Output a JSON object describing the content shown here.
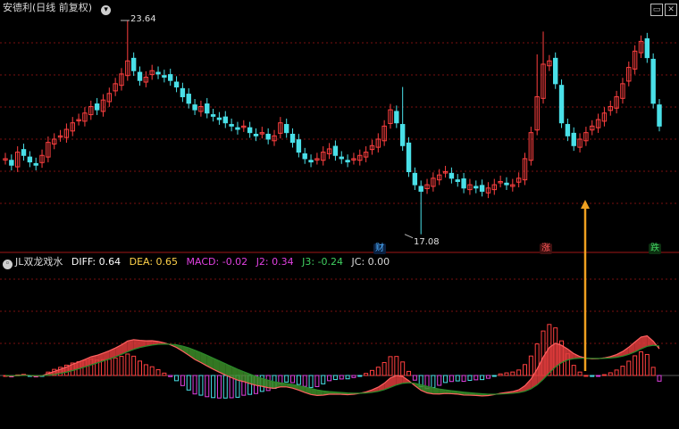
{
  "header": {
    "stock_name": "安德利(日线 前复权)",
    "dropdown_icon": "chevron-down-icon"
  },
  "window_controls": {
    "minimize_icon": "minimize-icon",
    "close_icon": "close-icon"
  },
  "price_annotations": {
    "high_label": "23.64",
    "low_label": "17.08"
  },
  "event_markers": [
    {
      "label": "财",
      "color": "#4fb0ff"
    },
    {
      "label": "涨",
      "color": "#ff5a5a"
    },
    {
      "label": "跌",
      "color": "#40d060"
    }
  ],
  "indicator": {
    "name": "JL双龙戏水",
    "values": [
      {
        "label": "DIFF: 0.64",
        "color": "#ffffff"
      },
      {
        "label": "DEA: 0.65",
        "color": "#ffd24a"
      },
      {
        "label": "MACD: -0.02",
        "color": "#e040e0"
      },
      {
        "label": "J2: 0.34",
        "color": "#e040e0"
      },
      {
        "label": "J3: -0.24",
        "color": "#40d060"
      },
      {
        "label": "JC: 0.00",
        "color": "#d8d8d8"
      }
    ]
  },
  "colors": {
    "up": "#ff4040",
    "down": "#4ae0e8",
    "grid": "#7a1010",
    "arrow": "#f0a020",
    "band_red": "#e03c3c",
    "band_green": "#3c8c28"
  },
  "chart_data": {
    "type": "candlestick",
    "price_high": 23.64,
    "price_low": 17.08,
    "closes": [
      19.4,
      19.2,
      19.6,
      19.5,
      19.3,
      19.2,
      19.5,
      19.9,
      20.0,
      20.1,
      20.3,
      20.5,
      20.6,
      20.8,
      21.0,
      20.9,
      21.2,
      21.4,
      21.7,
      22.0,
      22.4,
      22.1,
      21.8,
      21.9,
      22.1,
      22.0,
      21.9,
      21.8,
      21.6,
      21.3,
      21.1,
      20.9,
      21.0,
      20.8,
      20.7,
      20.6,
      20.5,
      20.4,
      20.3,
      20.4,
      20.2,
      20.1,
      20.2,
      20.0,
      20.1,
      20.5,
      20.2,
      19.9,
      19.6,
      19.4,
      19.3,
      19.4,
      19.6,
      19.7,
      19.5,
      19.4,
      19.3,
      19.4,
      19.5,
      19.6,
      19.8,
      20.0,
      20.4,
      20.9,
      20.5,
      19.8,
      19.0,
      18.6,
      18.4,
      18.6,
      18.8,
      18.9,
      19.0,
      18.8,
      18.7,
      18.5,
      18.6,
      18.5,
      18.4,
      18.5,
      18.6,
      18.7,
      18.6,
      18.6,
      18.8,
      19.4,
      20.2,
      21.3,
      22.3,
      22.4,
      21.7,
      20.5,
      20.1,
      19.8,
      20.0,
      20.2,
      20.4,
      20.6,
      20.8,
      21.0,
      21.3,
      21.7,
      22.2,
      22.7,
      23.0,
      22.5,
      21.1,
      20.4
    ]
  }
}
